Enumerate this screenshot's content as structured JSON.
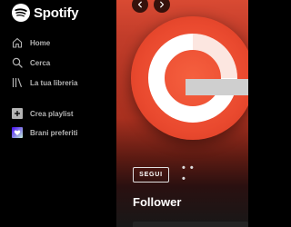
{
  "app": {
    "brand": "Spotify",
    "accent": "#1db954"
  },
  "sidebar": {
    "items": [
      {
        "label": "Home",
        "icon": "home-icon"
      },
      {
        "label": "Cerca",
        "icon": "search-icon"
      },
      {
        "label": "La tua libreria",
        "icon": "library-icon"
      }
    ],
    "actions": [
      {
        "label": "Crea playlist",
        "icon": "plus-icon"
      },
      {
        "label": "Brani preferiti",
        "icon": "heart-icon"
      }
    ]
  },
  "main": {
    "follow_label": "SEGUI",
    "more_label": "• • •",
    "section_title": "Follower",
    "background_color": "#c23d2a"
  }
}
